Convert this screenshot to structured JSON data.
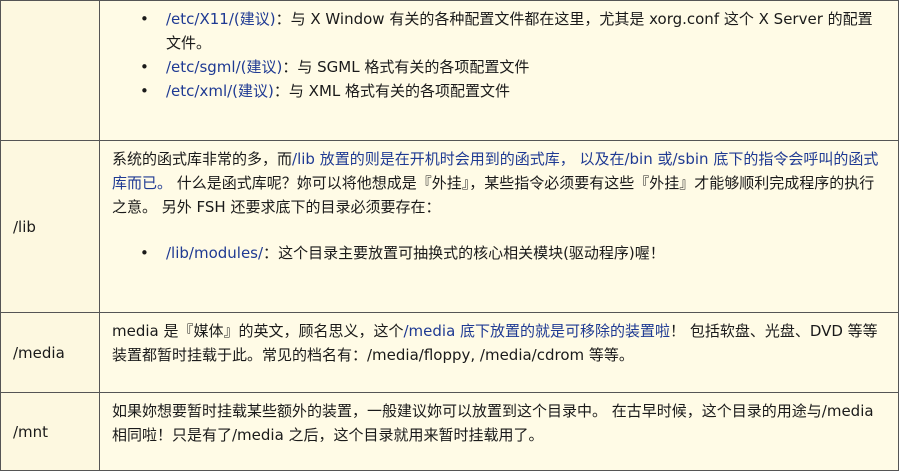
{
  "rows": [
    {
      "name": "",
      "items": [
        {
          "path": "/etc/X11/(建议)",
          "sep": "：",
          "text": "与 X Window 有关的各种配置文件都在这里，尤其是 xorg.conf 这个 X Server 的配置文件。"
        },
        {
          "path": "/etc/sgml/(建议)",
          "sep": "：",
          "text": "与 SGML 格式有关的各项配置文件"
        },
        {
          "path": "/etc/xml/(建议)",
          "sep": "：",
          "text": "与 XML 格式有关的各项配置文件"
        }
      ]
    },
    {
      "name": "/lib",
      "para_a": "系统的函式库非常的多，而",
      "para_b": "/lib 放置的则是在开机时会用到的函式库， 以及在/bin 或/sbin 底下的指令会呼叫的函式库而已。",
      "para_c": " 什么是函式库呢？妳可以将他想成是『外挂』，某些指令必须要有这些『外挂』才能够顺利完成程序的执行之意。 另外 FSH 还要求底下的目录必须要存在：",
      "item_path": "/lib/modules/",
      "item_sep": "：",
      "item_text": "这个目录主要放置可抽换式的核心相关模块(驱动程序)喔！"
    },
    {
      "name": "/media",
      "para_a": "media 是『媒体』的英文，顾名思义，这个",
      "para_b": "/media 底下放置的就是可移除的装置啦",
      "para_c": "！ 包括软盘、光盘、DVD 等等装置都暂时挂载于此。常见的档名有：/media/floppy, /media/cdrom 等等。"
    },
    {
      "name": "/mnt",
      "para": "如果妳想要暂时挂载某些额外的装置，一般建议妳可以放置到这个目录中。 在古早时候，这个目录的用途与/media 相同啦！只是有了/media 之后，这个目录就用来暂时挂载用了。"
    }
  ]
}
